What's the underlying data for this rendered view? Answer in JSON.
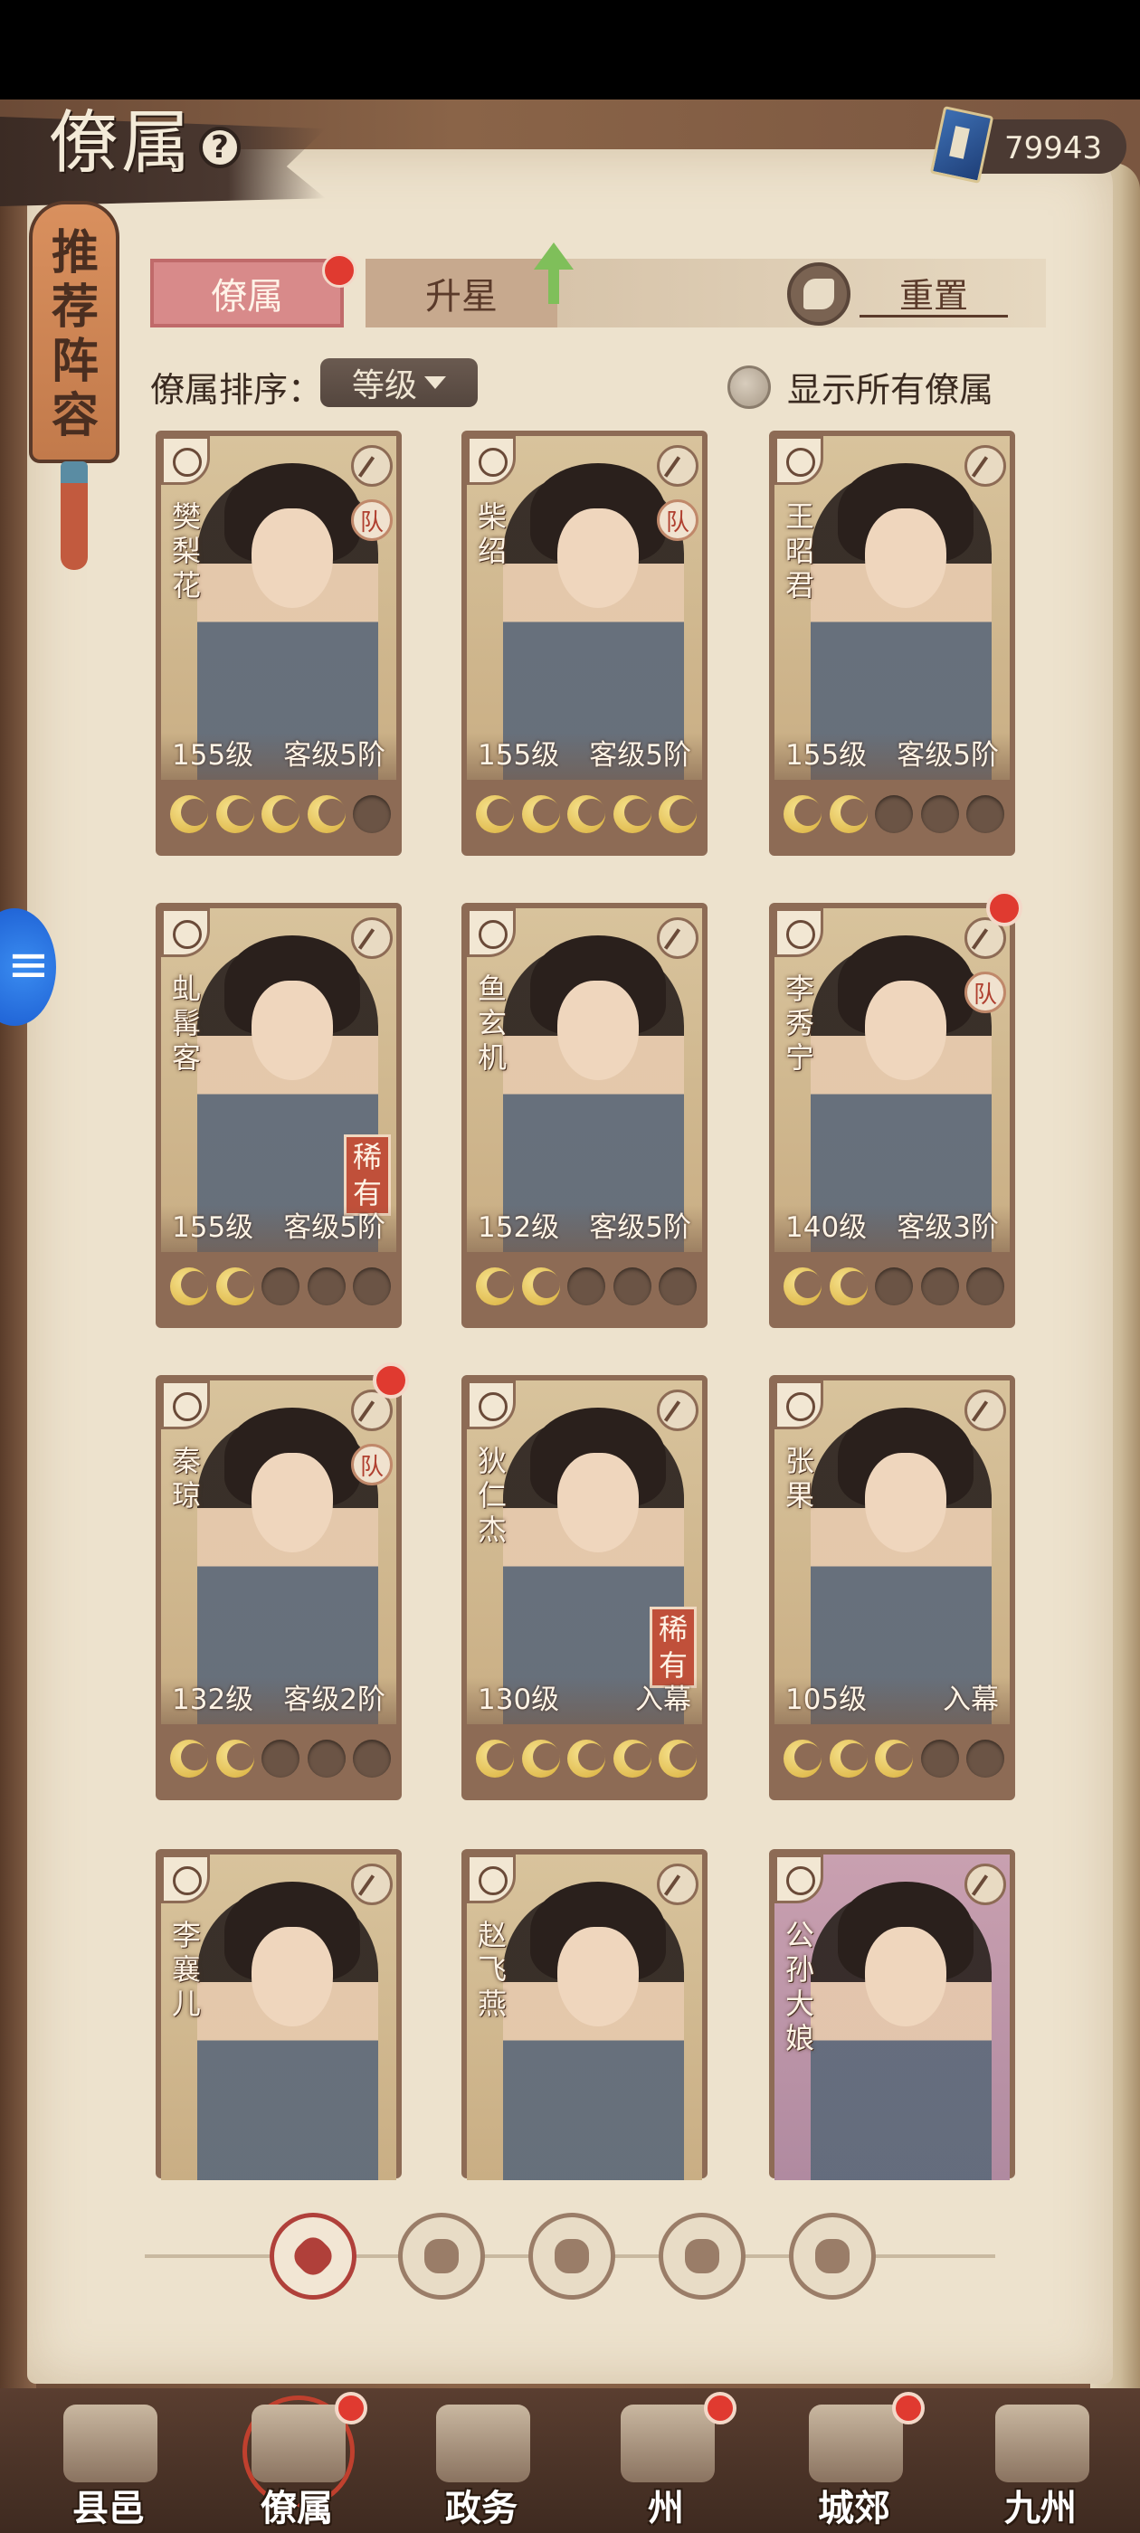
{
  "header": {
    "title": "僚属",
    "currency_value": "79943"
  },
  "side_tab": {
    "label": "推荐阵容"
  },
  "tabs": {
    "retainers": "僚属",
    "upgrade": "升星",
    "reset": "重置"
  },
  "sort": {
    "label": "僚属排序：",
    "value": "等级"
  },
  "show_all": {
    "label": "显示所有僚属"
  },
  "cards": [
    {
      "name": "樊梨花",
      "level": "155级",
      "rank": "客级5阶",
      "stars": 4,
      "team": "队",
      "rare": "",
      "dot": false
    },
    {
      "name": "柴绍",
      "level": "155级",
      "rank": "客级5阶",
      "stars": 5,
      "team": "队",
      "rare": "",
      "dot": false
    },
    {
      "name": "王昭君",
      "level": "155级",
      "rank": "客级5阶",
      "stars": 2,
      "team": "",
      "rare": "",
      "dot": false
    },
    {
      "name": "虬髯客",
      "level": "155级",
      "rank": "客级5阶",
      "stars": 2,
      "team": "",
      "rare": "稀有",
      "dot": false
    },
    {
      "name": "鱼玄机",
      "level": "152级",
      "rank": "客级5阶",
      "stars": 2,
      "team": "",
      "rare": "",
      "dot": false
    },
    {
      "name": "李秀宁",
      "level": "140级",
      "rank": "客级3阶",
      "stars": 2,
      "team": "队",
      "rare": "",
      "dot": true
    },
    {
      "name": "秦琼",
      "level": "132级",
      "rank": "客级2阶",
      "stars": 2,
      "team": "队",
      "rare": "",
      "dot": true
    },
    {
      "name": "狄仁杰",
      "level": "130级",
      "rank": "入幕",
      "stars": 5,
      "team": "",
      "rare": "稀有",
      "dot": false
    },
    {
      "name": "张果",
      "level": "105级",
      "rank": "入幕",
      "stars": 3,
      "team": "",
      "rare": "",
      "dot": false
    },
    {
      "name": "李襄儿",
      "level": "",
      "rank": "",
      "stars": 0,
      "team": "",
      "rare": "",
      "dot": false
    },
    {
      "name": "赵飞燕",
      "level": "",
      "rank": "",
      "stars": 0,
      "team": "",
      "rare": "",
      "dot": false
    },
    {
      "name": "公孙大娘",
      "level": "",
      "rank": "",
      "stars": 0,
      "team": "",
      "rare": "",
      "dot": false
    }
  ],
  "filters": [
    "all-filter-icon",
    "helmet-filter-icon",
    "cat-filter-icon",
    "fan-filter-icon",
    "beast-filter-icon"
  ],
  "bottom_nav": [
    {
      "label": "县邑",
      "dot": false,
      "active": false
    },
    {
      "label": "僚属",
      "dot": true,
      "active": true
    },
    {
      "label": "政务",
      "dot": false,
      "active": false
    },
    {
      "label": "州",
      "dot": true,
      "active": false
    },
    {
      "label": "城郊",
      "dot": true,
      "active": false
    },
    {
      "label": "九州",
      "dot": false,
      "active": false
    }
  ]
}
